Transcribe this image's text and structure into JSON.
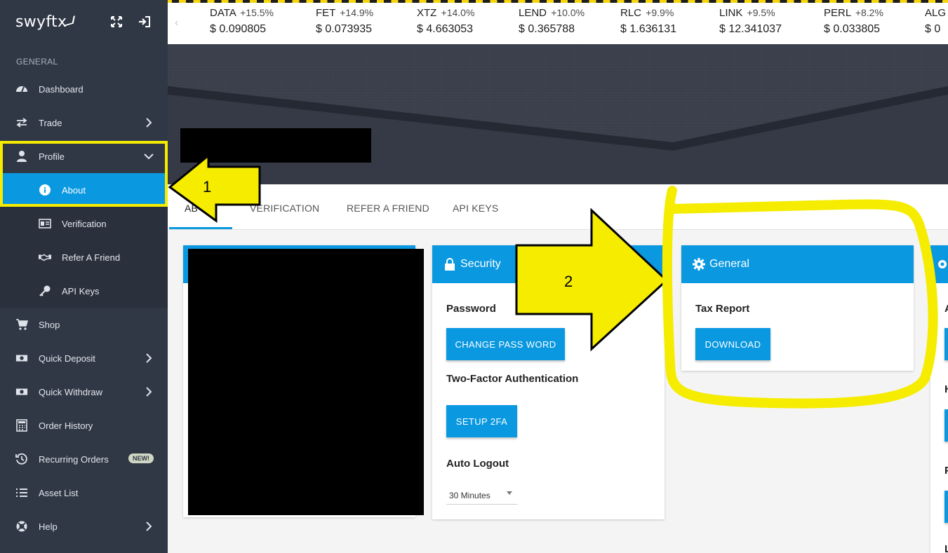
{
  "app": {
    "logo_text": "swyftx"
  },
  "sidebar": {
    "section_label": "GENERAL",
    "items": [
      {
        "label": "Dashboard",
        "icon": "speedometer-icon"
      },
      {
        "label": "Trade",
        "icon": "swap-arrows-icon",
        "has_chevron": true
      },
      {
        "label": "Profile",
        "icon": "person-icon",
        "expanded": true
      },
      {
        "label": "About",
        "icon": "info-icon",
        "sub": true,
        "active": true
      },
      {
        "label": "Verification",
        "icon": "id-card-icon",
        "sub": true
      },
      {
        "label": "Refer A Friend",
        "icon": "handshake-icon",
        "sub": true
      },
      {
        "label": "API Keys",
        "icon": "key-icon",
        "sub": true
      },
      {
        "label": "Shop",
        "icon": "cart-icon"
      },
      {
        "label": "Quick Deposit",
        "icon": "cash-icon",
        "has_chevron": true
      },
      {
        "label": "Quick Withdraw",
        "icon": "cash-icon",
        "has_chevron": true
      },
      {
        "label": "Order History",
        "icon": "calculator-icon"
      },
      {
        "label": "Recurring Orders",
        "icon": "history-icon",
        "badge": "NEW!"
      },
      {
        "label": "Asset List",
        "icon": "list-icon"
      },
      {
        "label": "Help",
        "icon": "lifebuoy-icon",
        "has_chevron": true
      }
    ]
  },
  "ticker": [
    {
      "symbol": "DATA",
      "change": "+15.5%",
      "price": "$ 0.090805"
    },
    {
      "symbol": "FET",
      "change": "+14.9%",
      "price": "$ 0.073935"
    },
    {
      "symbol": "XTZ",
      "change": "+14.0%",
      "price": "$ 4.663053"
    },
    {
      "symbol": "LEND",
      "change": "+10.0%",
      "price": "$ 0.365788"
    },
    {
      "symbol": "RLC",
      "change": "+9.9%",
      "price": "$ 1.636131"
    },
    {
      "symbol": "LINK",
      "change": "+9.5%",
      "price": "$ 12.341037"
    },
    {
      "symbol": "PERL",
      "change": "+8.2%",
      "price": "$ 0.033805"
    },
    {
      "symbol": "ALG",
      "change": "",
      "price": "$ 0"
    }
  ],
  "tabs": [
    {
      "label": "AB"
    },
    {
      "label": "VERIFICATION"
    },
    {
      "label": "REFER A FRIEND"
    },
    {
      "label": "API KEYS"
    }
  ],
  "security_card": {
    "title": "Security",
    "password_label": "Password",
    "change_password_button": "CHANGE PASS WORD",
    "twofa_label": "Two-Factor Authentication",
    "setup_2fa_button": "SETUP 2FA",
    "auto_logout_label": "Auto Logout",
    "auto_logout_value": "30 Minutes"
  },
  "general_card": {
    "title": "General",
    "tax_report_label": "Tax Report",
    "download_button": "DOWNLOAD"
  },
  "right_card_partial_letters": [
    "A",
    "H",
    "P",
    "L"
  ],
  "annotations": {
    "number_1": "1",
    "number_2": "2",
    "color_highlight": "#f5ec00"
  },
  "colors": {
    "sidebar_bg": "#303846",
    "accent_blue": "#0a98e0",
    "banner_bg": "#2e3340"
  }
}
